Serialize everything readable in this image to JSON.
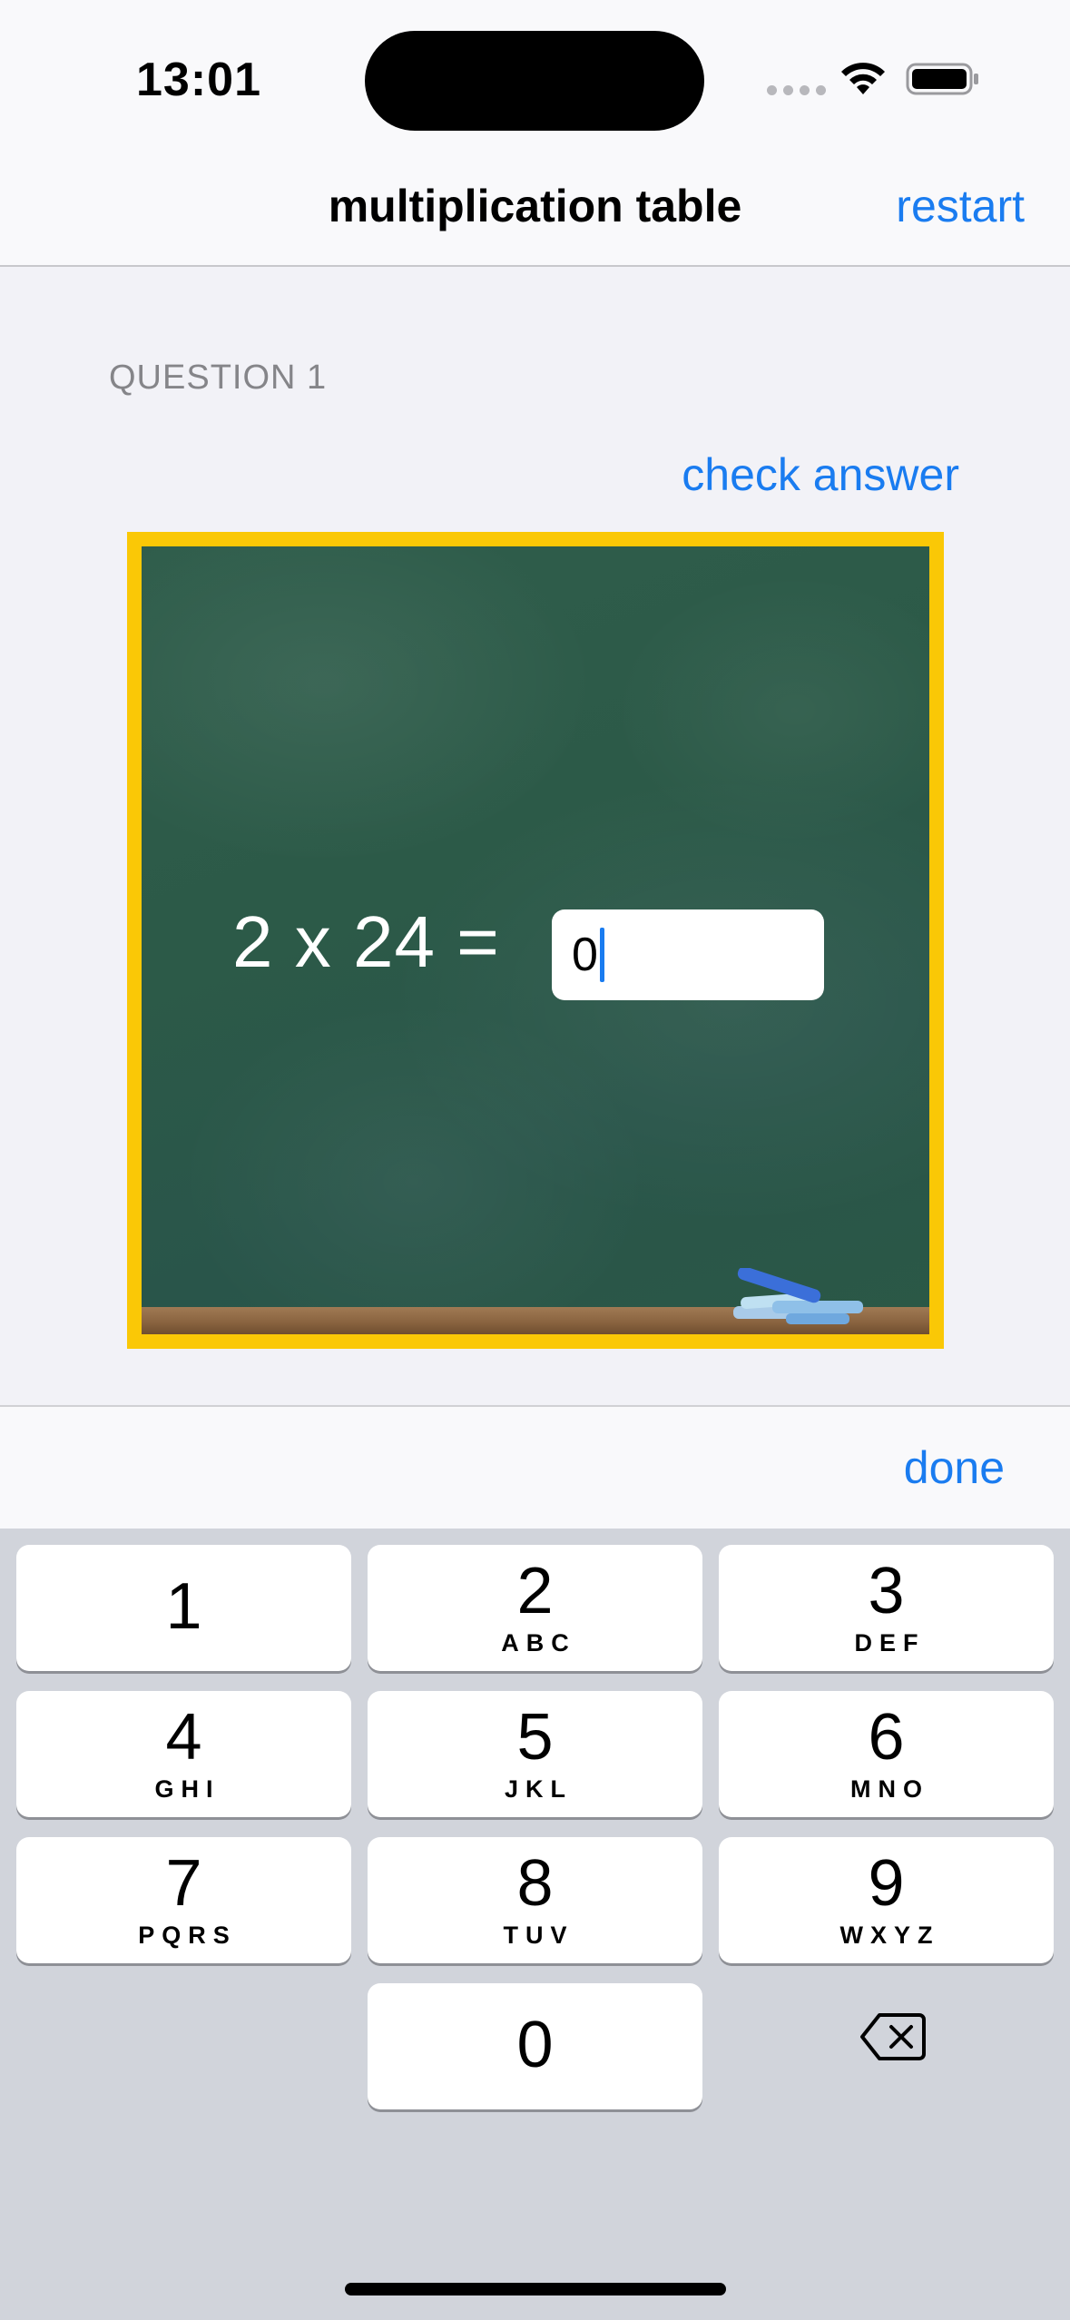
{
  "status_bar": {
    "time": "13:01"
  },
  "nav": {
    "title": "multiplication table",
    "restart_label": "restart"
  },
  "question": {
    "section_label": "QUESTION 1",
    "check_label": "check answer",
    "equation": "2 x 24 =",
    "answer_value": "0"
  },
  "accessory": {
    "done_label": "done"
  },
  "keypad": {
    "keys": [
      {
        "digit": "1",
        "letters": ""
      },
      {
        "digit": "2",
        "letters": "ABC"
      },
      {
        "digit": "3",
        "letters": "DEF"
      },
      {
        "digit": "4",
        "letters": "GHI"
      },
      {
        "digit": "5",
        "letters": "JKL"
      },
      {
        "digit": "6",
        "letters": "MNO"
      },
      {
        "digit": "7",
        "letters": "PQRS"
      },
      {
        "digit": "8",
        "letters": "TUV"
      },
      {
        "digit": "9",
        "letters": "WXYZ"
      },
      {
        "digit": "0",
        "letters": ""
      }
    ]
  },
  "colors": {
    "accent": "#1a7cf0",
    "board_frame": "#fac806",
    "board": "#2c5a48",
    "keyboard_bg": "#d1d4db"
  },
  "icons": [
    "wifi-icon",
    "battery-icon",
    "cellular-signal-icon",
    "chalk-icon",
    "delete-backspace-icon"
  ]
}
